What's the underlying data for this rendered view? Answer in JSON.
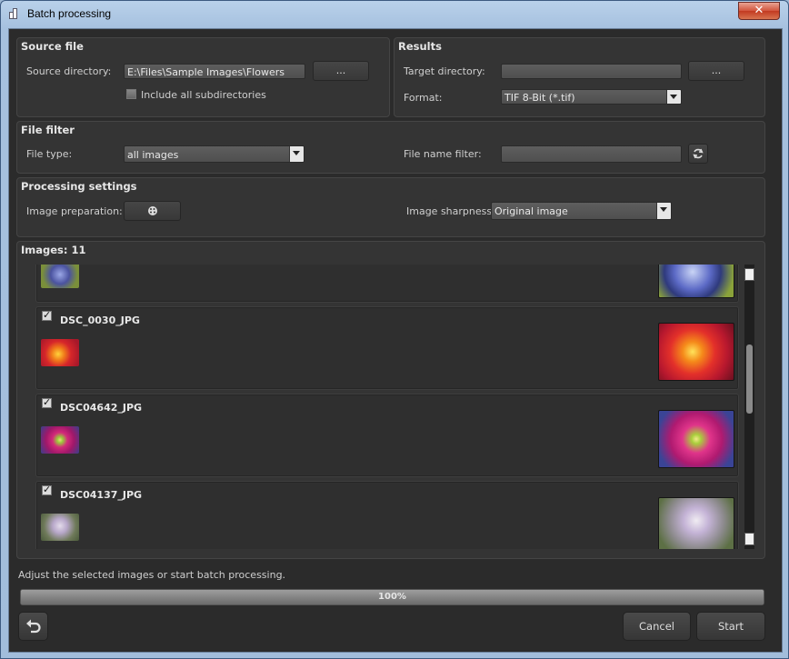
{
  "window": {
    "title": "Batch processing",
    "close_label": "✕"
  },
  "source": {
    "title": "Source file",
    "dir_label": "Source directory:",
    "dir_value": "E:\\Files\\Sample Images\\Flowers",
    "browse_label": "...",
    "subdirs_label": "Include all subdirectories",
    "subdirs_checked": false
  },
  "results": {
    "title": "Results",
    "target_label": "Target directory:",
    "target_value": "",
    "browse_label": "...",
    "format_label": "Format:",
    "format_value": "TIF 8-Bit (*.tif)"
  },
  "filter": {
    "title": "File filter",
    "type_label": "File type:",
    "type_value": "all images",
    "name_label": "File name filter:",
    "name_value": ""
  },
  "processing": {
    "title": "Processing settings",
    "prep_label": "Image preparation:",
    "sharpness_label": "Image sharpness:",
    "sharpness_value": "Original image"
  },
  "images": {
    "title": "Images: 11",
    "items": [
      {
        "name": "DSC_0030_JPG",
        "checked": true
      },
      {
        "name": "DSC04642_JPG",
        "checked": true
      },
      {
        "name": "DSC04137_JPG",
        "checked": true
      }
    ]
  },
  "status_text": "Adjust the selected images or start batch processing.",
  "progress": {
    "value": 1.0,
    "label": "100%"
  },
  "buttons": {
    "cancel": "Cancel",
    "start": "Start"
  }
}
